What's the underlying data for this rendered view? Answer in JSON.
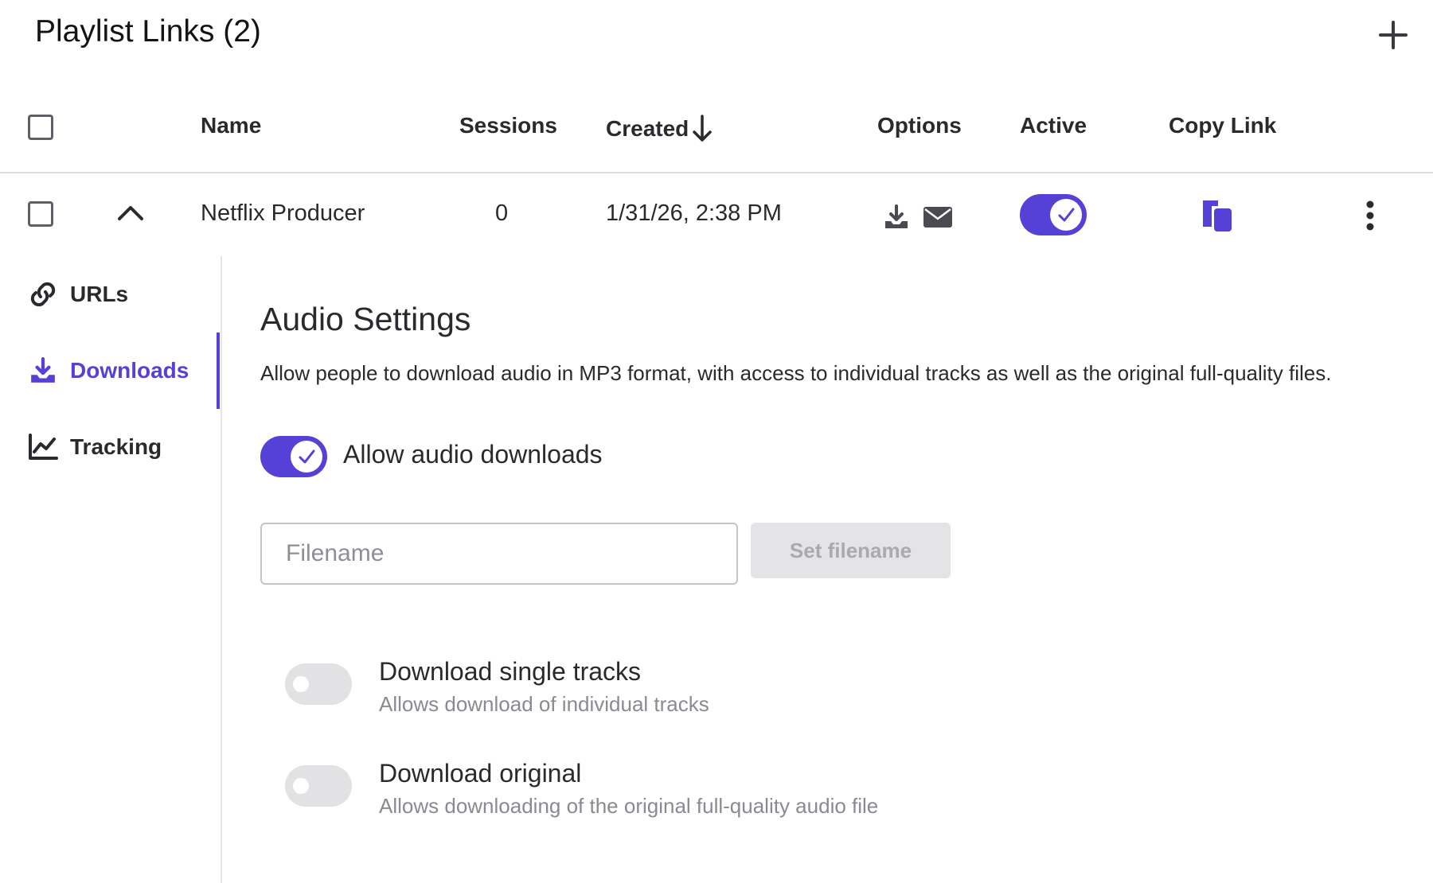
{
  "header": {
    "title": "Playlist Links (2)",
    "add_icon": "plus-icon"
  },
  "table": {
    "columns": [
      "Name",
      "Sessions",
      "Created",
      "Options",
      "Active",
      "Copy Link"
    ],
    "sort": {
      "column": "Created",
      "direction": "descending",
      "icon": "arrow-down-icon"
    },
    "rows": [
      {
        "name": "Netflix Producer",
        "sessions": "0",
        "created": "1/31/26, 2:38 PM",
        "options_icons": [
          "download-icon",
          "envelope-icon"
        ],
        "active": true,
        "expanded": true
      }
    ]
  },
  "detail_nav": {
    "items": [
      {
        "label": "URLs",
        "icon": "link-icon",
        "active": false
      },
      {
        "label": "Downloads",
        "icon": "download-icon",
        "active": true
      },
      {
        "label": "Tracking",
        "icon": "chart-line-icon",
        "active": false
      }
    ]
  },
  "audio_settings": {
    "title": "Audio Settings",
    "description": "Allow people to download audio in MP3 format, with access to individual tracks as well as the original full-quality files.",
    "allow_downloads_label": "Allow audio downloads",
    "allow_downloads_enabled": true,
    "filename": {
      "value": "",
      "placeholder": "Filename"
    },
    "set_filename_button": "Set filename",
    "options": [
      {
        "title": "Download single tracks",
        "description": "Allows download of individual tracks",
        "enabled": false
      },
      {
        "title": "Download original",
        "description": "Allows downloading of the original full-quality audio file",
        "enabled": false
      }
    ]
  },
  "colors": {
    "accent": "#5641d6",
    "text": "#2a2a2e",
    "muted": "#8a8a90",
    "toggle_off": "#e2e2e5",
    "divider": "#dcdce0"
  }
}
